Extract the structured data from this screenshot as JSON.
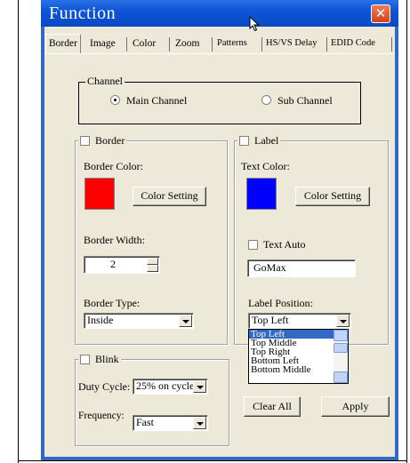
{
  "window": {
    "title": "Function",
    "close_glyph": "✕"
  },
  "tabs": [
    {
      "label": "Border",
      "active": true
    },
    {
      "label": "Image"
    },
    {
      "label": "Color"
    },
    {
      "label": "Zoom"
    },
    {
      "label": "Patterns"
    },
    {
      "label": "HS/VS Delay"
    },
    {
      "label": "EDID Code"
    }
  ],
  "channel": {
    "legend": "Channel",
    "main_label": "Main Channel",
    "sub_label": "Sub Channel",
    "selected": "main"
  },
  "border": {
    "legend": "Border",
    "checked": false,
    "color_label": "Border Color:",
    "color": "#ff0000",
    "color_setting_button": "Color Setting",
    "width_label": "Border Width:",
    "width_value": "2",
    "type_label": "Border Type:",
    "type_value": "Inside"
  },
  "label": {
    "legend": "Label",
    "checked": false,
    "text_color_label": "Text Color:",
    "text_color": "#0000ff",
    "color_setting_button": "Color Setting",
    "text_auto_label": "Text Auto",
    "text_auto_checked": false,
    "text_value": "GoMax",
    "position_label": "Label Position:",
    "position_value": "Top Left",
    "position_options": [
      "Top Left",
      "Top Middle",
      "Top Right",
      "Bottom Left",
      "Bottom Middle"
    ]
  },
  "blink": {
    "legend": "Blink",
    "checked": false,
    "duty_cycle_label": "Duty Cycle:",
    "duty_cycle_value": "25% on cycle",
    "frequency_label": "Frequency:",
    "frequency_value": "Fast"
  },
  "actions": {
    "clear_all": "Clear All",
    "apply": "Apply"
  }
}
